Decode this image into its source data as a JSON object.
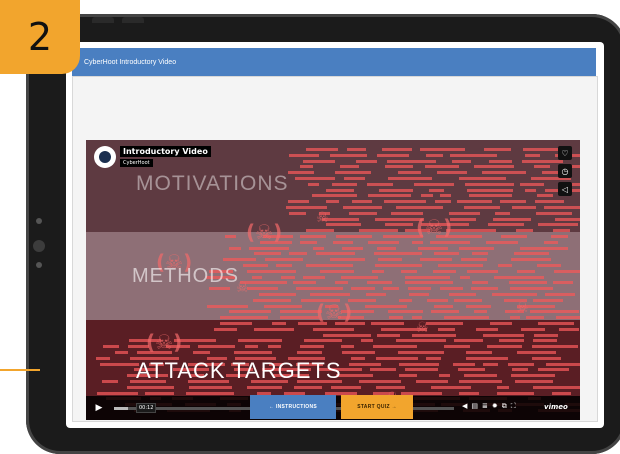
{
  "step_badge": "2",
  "app": {
    "header_title": "CyberHoot Introductory Video"
  },
  "video": {
    "title": "Introductory Video",
    "owner": "CyberHoot",
    "overlay_words": [
      "MOTIVATIONS",
      "METHODS",
      "ATTACK TARGETS"
    ],
    "time": "00:12",
    "progress": 0.04,
    "vimeo_label": "vimeo",
    "side_buttons": [
      {
        "icon": "heart-icon",
        "glyph": "♡"
      },
      {
        "icon": "clock-icon",
        "glyph": "◷"
      },
      {
        "icon": "share-icon",
        "glyph": "◁"
      }
    ],
    "controls": [
      {
        "icon": "volume-icon",
        "glyph": "◀"
      },
      {
        "icon": "captions-icon",
        "glyph": "▤"
      },
      {
        "icon": "chapters-icon",
        "glyph": "≣"
      },
      {
        "icon": "settings-icon",
        "glyph": "✹"
      },
      {
        "icon": "pip-icon",
        "glyph": "⧉"
      },
      {
        "icon": "fullscreen-icon",
        "glyph": "⛶"
      }
    ],
    "background_skulls": [
      "(☠)",
      "☠",
      "(☠)",
      "☠",
      "(☠)",
      "☠",
      "(☠)",
      "☠",
      "(☠)",
      "☠"
    ],
    "accent_colors": {
      "code_lines": "#f2585a",
      "top_band": "#5e3a41",
      "mid_band": "#8e6f76",
      "bottom_band": "#5a1e24"
    }
  },
  "buttons": {
    "instructions": "← INSTRUCTIONS",
    "start_quiz": "START QUIZ →"
  },
  "colors": {
    "brand_blue": "#4a7fc1",
    "brand_orange": "#f2a52d"
  }
}
